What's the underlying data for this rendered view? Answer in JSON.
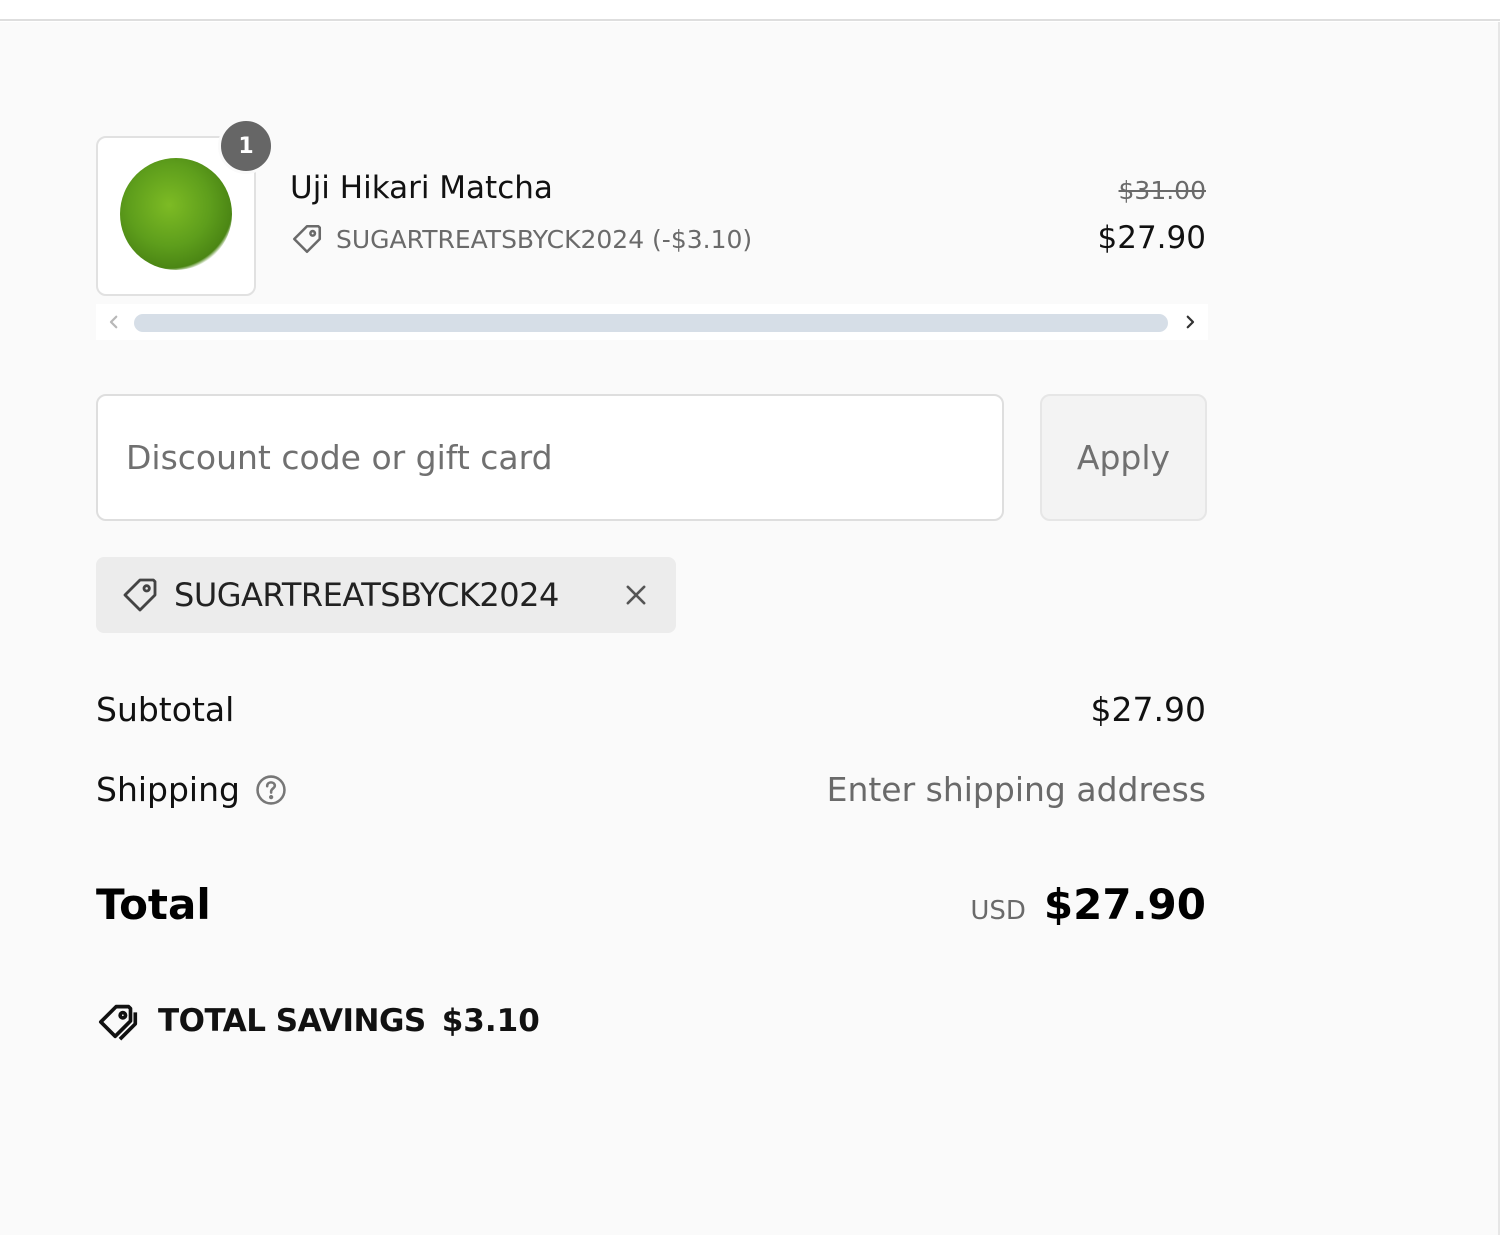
{
  "cart": {
    "item": {
      "name": "Uji Hikari Matcha",
      "quantity": "1",
      "discount_code_line": "SUGARTREATSBYCK2024 (-$3.10)",
      "original_price": "$31.00",
      "price": "$27.90",
      "image_icon": "matcha-powder-image"
    }
  },
  "discount": {
    "placeholder": "Discount code or gift card",
    "value": "",
    "apply_label": "Apply",
    "applied_code": "SUGARTREATSBYCK2024"
  },
  "summary": {
    "subtotal_label": "Subtotal",
    "subtotal_value": "$27.90",
    "shipping_label": "Shipping",
    "shipping_value": "Enter shipping address",
    "total_label": "Total",
    "currency": "USD",
    "total_value": "$27.90",
    "savings_label": "TOTAL SAVINGS",
    "savings_value": "$3.10"
  },
  "colors": {
    "panel_background": "#fafafa",
    "badge": "#666666",
    "muted_text": "#6a6a6a",
    "scrollbar_track": "#d6dee7"
  }
}
